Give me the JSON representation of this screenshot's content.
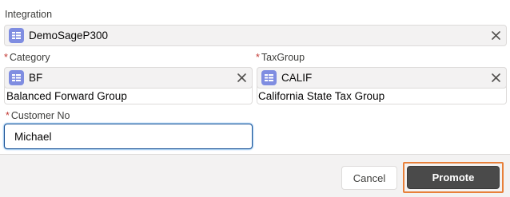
{
  "integration": {
    "label": "Integration",
    "value": "DemoSageP300"
  },
  "category": {
    "required_marker": "*",
    "label": "Category",
    "value": "BF",
    "description": "Balanced Forward Group"
  },
  "tax_group": {
    "required_marker": "*",
    "label": "TaxGroup",
    "value": "CALIF",
    "description": "California State Tax Group"
  },
  "customer_no": {
    "required_marker": "*",
    "label": "Customer No",
    "value": "Michael"
  },
  "footer": {
    "cancel_label": "Cancel",
    "promote_label": "Promote"
  },
  "colors": {
    "record_icon": "#7f8de1",
    "required": "#c23934",
    "focus_border": "#1b5297",
    "promote_bg": "#4a4a4a",
    "promote_highlight": "#e8803a"
  },
  "icons": {
    "record": "record-icon",
    "remove": "close-icon"
  }
}
